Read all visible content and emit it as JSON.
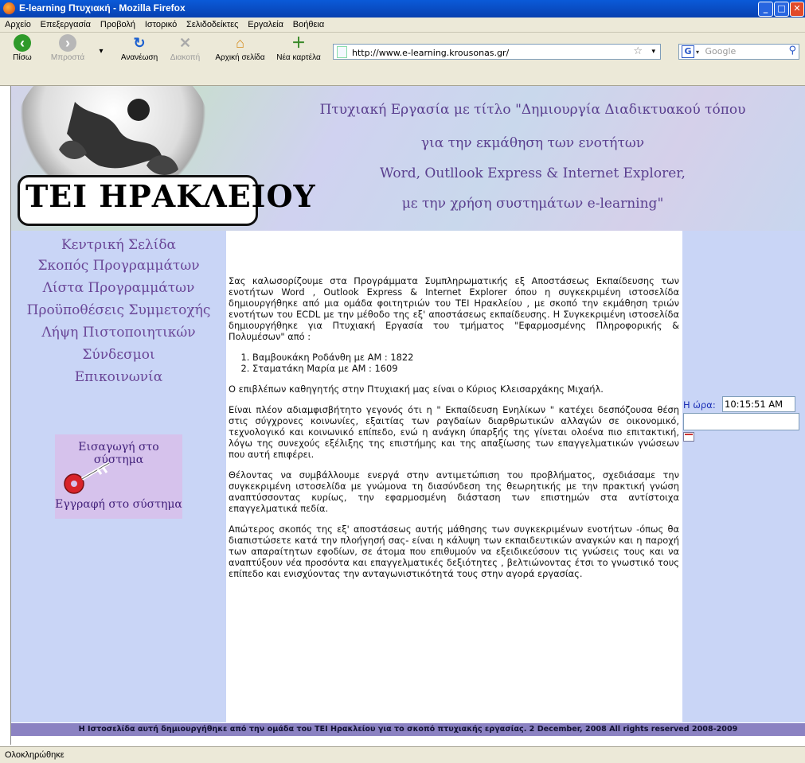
{
  "window": {
    "title": "E-learning Πτυχιακή - Mozilla Firefox"
  },
  "menu": [
    "Αρχείο",
    "Επεξεργασία",
    "Προβολή",
    "Ιστορικό",
    "Σελιδοδείκτες",
    "Εργαλεία",
    "Βοήθεια"
  ],
  "toolbar": {
    "back": "Πίσω",
    "forward": "Μπροστά",
    "reload": "Ανανέωση",
    "stop": "Διακοπή",
    "home": "Αρχική σελίδα",
    "newtab": "Νέα καρτέλα",
    "url": "http://www.e-learning.krousonas.gr/",
    "search_placeholder": "Google"
  },
  "header": {
    "logo_text": "ΤΕΙ ΗΡΑΚΛΕΙΟΥ",
    "line1": "Πτυχιακή Εργασία με τίτλο \"Δημιουργία Διαδικτυακού τόπου",
    "line2": "για την εκμάθηση των ενοτήτων",
    "line3": "Word, Outllook Express & Internet Explorer,",
    "line4": "με την χρήση συστημάτων e-learning\""
  },
  "sidebar": {
    "items": [
      "Κεντρική Σελίδα",
      "Σκοπός Προγραμμάτων",
      "Λίστα Προγραμμάτων",
      "Προϋποθέσεις Συμμετοχής",
      "Λήψη Πιστοποιητικών",
      "Σύνδεσμοι",
      "Επικοινωνία"
    ],
    "login": "Εισαγωγή στο σύστημα",
    "register": "Εγγραφή στο σύστημα"
  },
  "main": {
    "intro": "Σας καλωσορίζουμε στα Προγράμματα Συμπληρωματικής εξ Αποστάσεως Εκπαίδευσης των ενοτήτων Word , Outlook Express & Internet Explorer όπου η συγκεκριμένη ιστοσελίδα δημιουργήθηκε από μια ομάδα φοιτητριών του ΤΕΙ Ηρακλείου , με σκοπό την εκμάθηση τριών ενοτήτων του ECDL με την μέθοδο της εξ' αποστάσεως εκπαίδευσης. Η Συγκεκριμένη ιστοσελίδα δημιουργήθηκε για Πτυχιακή Εργασία του τμήματος \"Εφαρμοσμένης Πληροφορικής & Πολυμέσων\" από :",
    "authors": [
      "Βαμβουκάκη Ροδάνθη με ΑΜ : 1822",
      "Σταματάκη Μαρία με ΑΜ : 1609"
    ],
    "supervisor": "Ο επιβλέπων καθηγητής στην Πτυχιακή μας είναι ο Κύριος Κλεισαρχάκης Μιχαήλ.",
    "p2": "Είναι πλέον αδιαμφισβήτητο γεγονός ότι η \" Εκπαίδευση Ενηλίκων \" κατέχει δεσπόζουσα θέση στις σύγχρονες κοινωνίες, εξαιτίας των ραγδαίων διαρθρωτικών αλλαγών σε οικονομικό, τεχνολογικό και κοινωνικό επίπεδο, ενώ η ανάγκη ύπαρξής της γίνεται ολοένα πιο επιτακτική, λόγω της συνεχούς εξέλιξης της επιστήμης και της απαξίωσης των επαγγελματικών γνώσεων που αυτή επιφέρει.",
    "p3": "Θέλοντας να συμβάλλουμε ενεργά στην αντιμετώπιση του προβλήματος, σχεδιάσαμε την συγκεκριμένη ιστοσελίδα με γνώμονα τη διασύνδεση της θεωρητικής με την πρακτική γνώση αναπτύσσοντας κυρίως, την εφαρμοσμένη διάσταση των επιστημών στα αντίστοιχα επαγγελματικά πεδία.",
    "p4": "Απώτερος σκοπός της εξ' αποστάσεως αυτής μάθησης των συγκεκριμένων ενοτήτων -όπως θα διαπιστώσετε κατά την πλοήγησή σας- είναι η κάλυψη των εκπαιδευτικών αναγκών και η παροχή των απαραίτητων εφοδίων, σε άτομα που επιθυμούν να εξειδικεύσουν τις γνώσεις τους και να αναπτύξουν νέα προσόντα και επαγγελματικές δεξιότητες , βελτιώνοντας έτσι το γνωστικό τους επίπεδο και ενισχύοντας την ανταγωνιστικότητά τους στην αγορά εργασίας."
  },
  "right": {
    "time_label": "Η ώρα:",
    "time_value": "10:15:51 AM"
  },
  "footer": "Η Ιστοσελίδα αυτή δημιουργήθηκε από την ομάδα του ΤΕΙ Ηρακλείου για το σκοπό πτυχιακής εργασίας. 2 December, 2008 All rights reserved 2008-2009",
  "status": "Ολοκληρώθηκε"
}
